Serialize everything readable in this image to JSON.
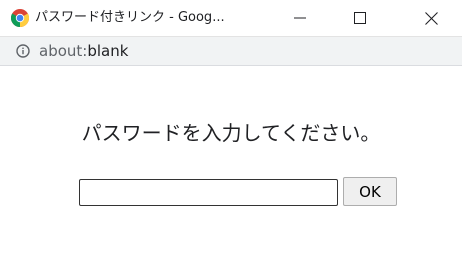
{
  "window": {
    "title": "パスワード付きリンク - Goog...",
    "minimize_icon": "minimize-icon",
    "maximize_icon": "maximize-icon",
    "close_icon": "close-icon",
    "browser_icon": "chrome-logo-icon"
  },
  "address_bar": {
    "scheme": "about:",
    "path": "blank",
    "info_icon": "info-icon"
  },
  "dialog": {
    "prompt": "パスワードを入力してください。",
    "password_value": "",
    "ok_label": "OK"
  }
}
